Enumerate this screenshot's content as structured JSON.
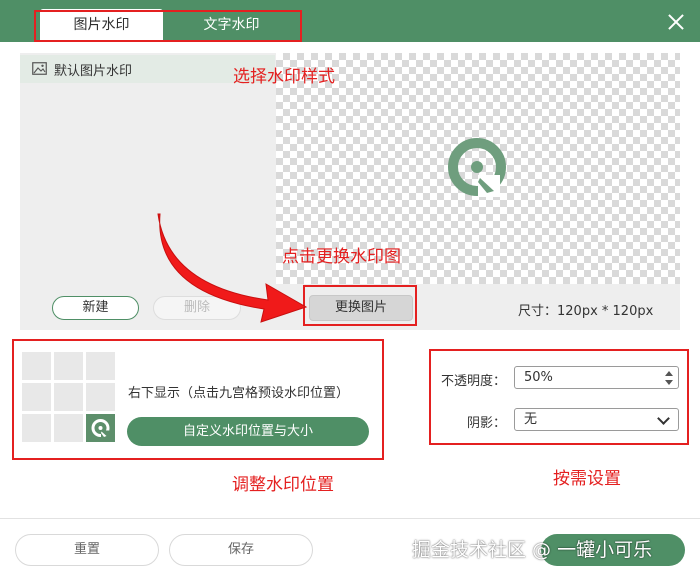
{
  "tabs": {
    "image": "图片水印",
    "text": "文字水印"
  },
  "list": {
    "default_item": "默认图片水印"
  },
  "buttons": {
    "new": "新建",
    "delete": "删除",
    "change_image": "更换图片",
    "custom_position": "自定义水印位置与大小",
    "reset": "重置",
    "save": "保存"
  },
  "size": {
    "label": "尺寸：120px * 120px"
  },
  "position": {
    "label": "右下显示（点击九宫格预设水印位置）"
  },
  "settings": {
    "opacity_label": "不透明度：",
    "opacity_value": "50%",
    "shadow_label": "阴影：",
    "shadow_value": "无"
  },
  "annotations": {
    "select_style": "选择水印样式",
    "change_image": "点击更换水印图",
    "adjust_position": "调整水印位置",
    "as_needed": "按需设置"
  },
  "watermark_text": "掘金技术社区 @ 一罐小可乐",
  "colors": {
    "brand_green": "#4f8f66",
    "annotation_red": "#e42020"
  },
  "icons": {
    "close": "close-icon",
    "image": "image-icon",
    "logo": "watermark-logo-icon",
    "arrow": "red-arrow"
  }
}
